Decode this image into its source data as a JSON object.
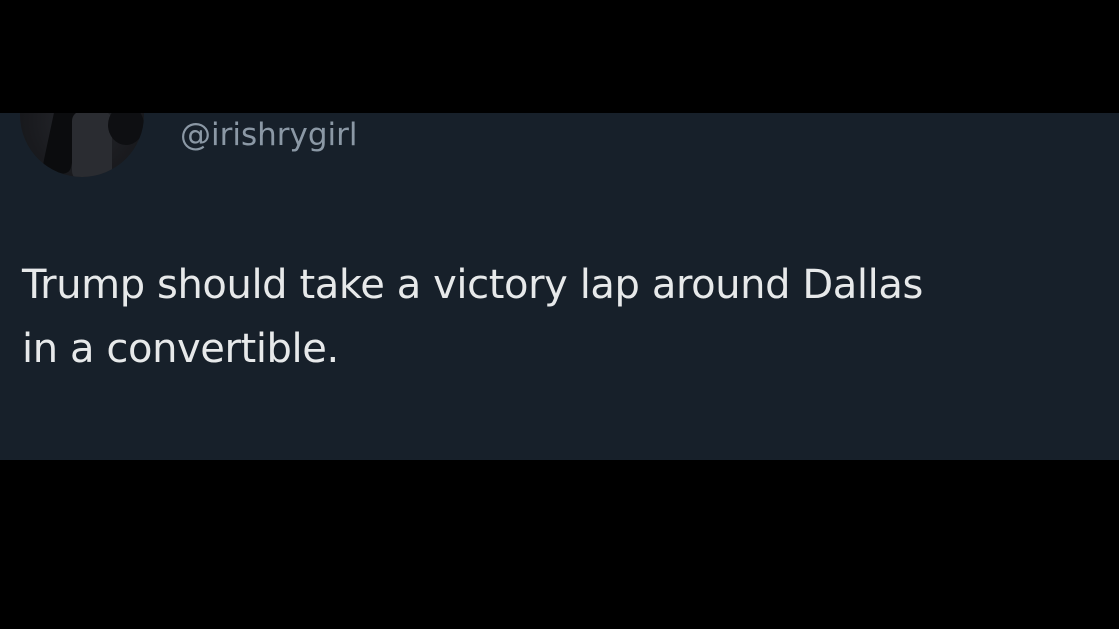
{
  "tweet": {
    "handle": "@irishrygirl",
    "text_lines": [
      "Trump should take a victory lap around Dallas",
      "in a convertible."
    ]
  },
  "colors": {
    "background": "#000000",
    "card": "#17202a",
    "handle": "#8b98a5",
    "text": "#e7e9ea"
  }
}
